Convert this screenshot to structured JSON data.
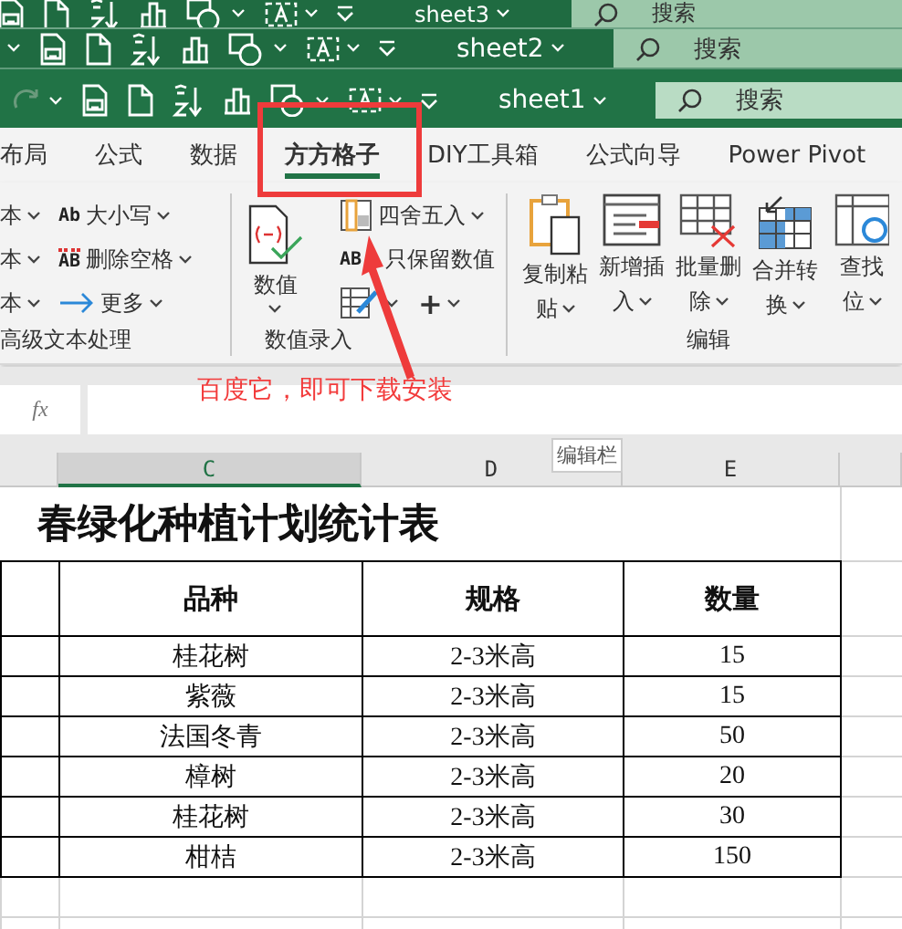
{
  "windows": [
    {
      "title": "sheet3",
      "search": {
        "placeholder": "搜索"
      }
    },
    {
      "title": "sheet2",
      "search": {
        "placeholder": "搜索"
      }
    },
    {
      "title": "sheet1",
      "search": {
        "placeholder": "搜索"
      }
    }
  ],
  "ribbon": {
    "tabs": [
      {
        "label": "布局",
        "selected": false
      },
      {
        "label": "公式",
        "selected": false
      },
      {
        "label": "数据",
        "selected": false
      },
      {
        "label": "方方格子",
        "selected": true
      },
      {
        "label": "DIY工具箱",
        "selected": false
      },
      {
        "label": "公式向导",
        "selected": false
      },
      {
        "label": "Power Pivot",
        "selected": false
      }
    ],
    "groups": [
      {
        "label": "高级文本处理",
        "columns": [
          [
            {
              "label": "本",
              "dropdown": true
            },
            {
              "label": "本",
              "dropdown": true
            },
            {
              "label": "本",
              "dropdown": true
            }
          ],
          [
            {
              "glyph": "Ab",
              "label": "大小写",
              "dropdown": true
            },
            {
              "glyph": "AB",
              "label": "删除空格",
              "dropdown": true
            },
            {
              "label": "更多",
              "dropdown": true
            }
          ]
        ]
      },
      {
        "label": "数值录入",
        "large": [
          {
            "lines": [
              "数值"
            ],
            "dropdown": true
          }
        ],
        "columns": [
          [
            {
              "label": "四舍五入",
              "dropdown": true
            },
            {
              "glyph": "AB",
              "label": "只保留数值",
              "dropdown": false
            },
            {
              "glyph": "+",
              "dropdown": true
            }
          ]
        ]
      },
      {
        "label": "编辑",
        "large": [
          {
            "lines": [
              "复制粘",
              "贴"
            ],
            "dropdown": true
          },
          {
            "lines": [
              "新增插",
              "入"
            ],
            "dropdown": true
          },
          {
            "lines": [
              "批量删",
              "除"
            ],
            "dropdown": true
          },
          {
            "lines": [
              "合并转",
              "换"
            ],
            "dropdown": true
          },
          {
            "lines": [
              "查找",
              "位"
            ],
            "dropdown": true
          }
        ]
      }
    ]
  },
  "annotation": {
    "text": "百度它，即可下载安装"
  },
  "formula_bar": {
    "function_label": "fx"
  },
  "tooltip": {
    "text": "编辑栏"
  },
  "column_headers": [
    {
      "label": "C",
      "selected": true
    },
    {
      "label": "D",
      "selected": false
    },
    {
      "label": "E",
      "selected": false
    }
  ],
  "sheet": {
    "title": "春绿化种植计划统计表",
    "columns": [
      "品种",
      "规格",
      "数量"
    ],
    "rows": [
      [
        "桂花树",
        "2-3米高",
        "15"
      ],
      [
        "紫薇",
        "2-3米高",
        "15"
      ],
      [
        "法国冬青",
        "2-3米高",
        "50"
      ],
      [
        "樟树",
        "2-3米高",
        "20"
      ],
      [
        "桂花树",
        "2-3米高",
        "30"
      ],
      [
        "柑桔",
        "2-3米高",
        "150"
      ]
    ]
  }
}
